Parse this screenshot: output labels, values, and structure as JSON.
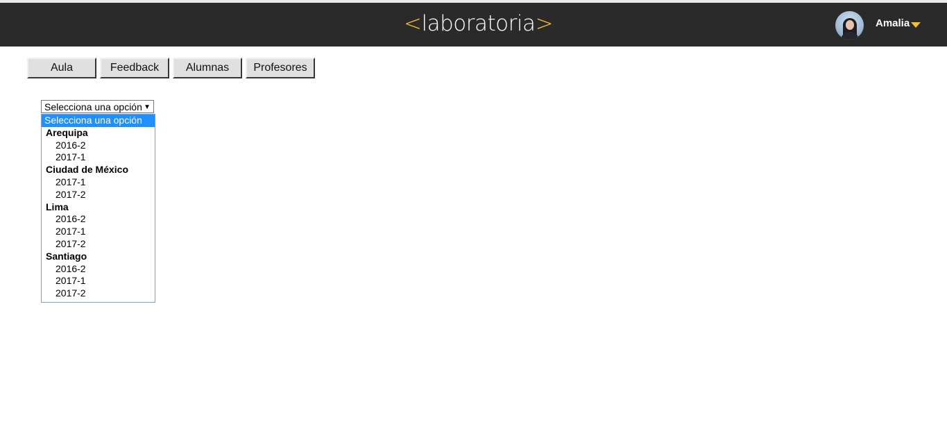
{
  "header": {
    "logo": {
      "open": "<",
      "word": "laboratoria",
      "close": ">"
    },
    "user_name": "Amalia",
    "accent_color": "#f5c12e",
    "bg_color": "#2a2a2a",
    "avatar_icon": "avatar-photo",
    "user_menu_icon": "caret-down-icon"
  },
  "nav": {
    "tabs": [
      {
        "label": "Aula"
      },
      {
        "label": "Feedback"
      },
      {
        "label": "Alumnas"
      },
      {
        "label": "Profesores"
      }
    ]
  },
  "select": {
    "current_value": "Selecciona una opción",
    "arrow": "▼",
    "options": {
      "default": "Selecciona una opción",
      "groups": [
        {
          "label": "Arequipa",
          "items": [
            "2016-2",
            "2017-1"
          ]
        },
        {
          "label": "Ciudad de México",
          "items": [
            "2017-1",
            "2017-2"
          ]
        },
        {
          "label": "Lima",
          "items": [
            "2016-2",
            "2017-1",
            "2017-2"
          ]
        },
        {
          "label": "Santiago",
          "items": [
            "2016-2",
            "2017-1",
            "2017-2"
          ]
        }
      ]
    }
  }
}
